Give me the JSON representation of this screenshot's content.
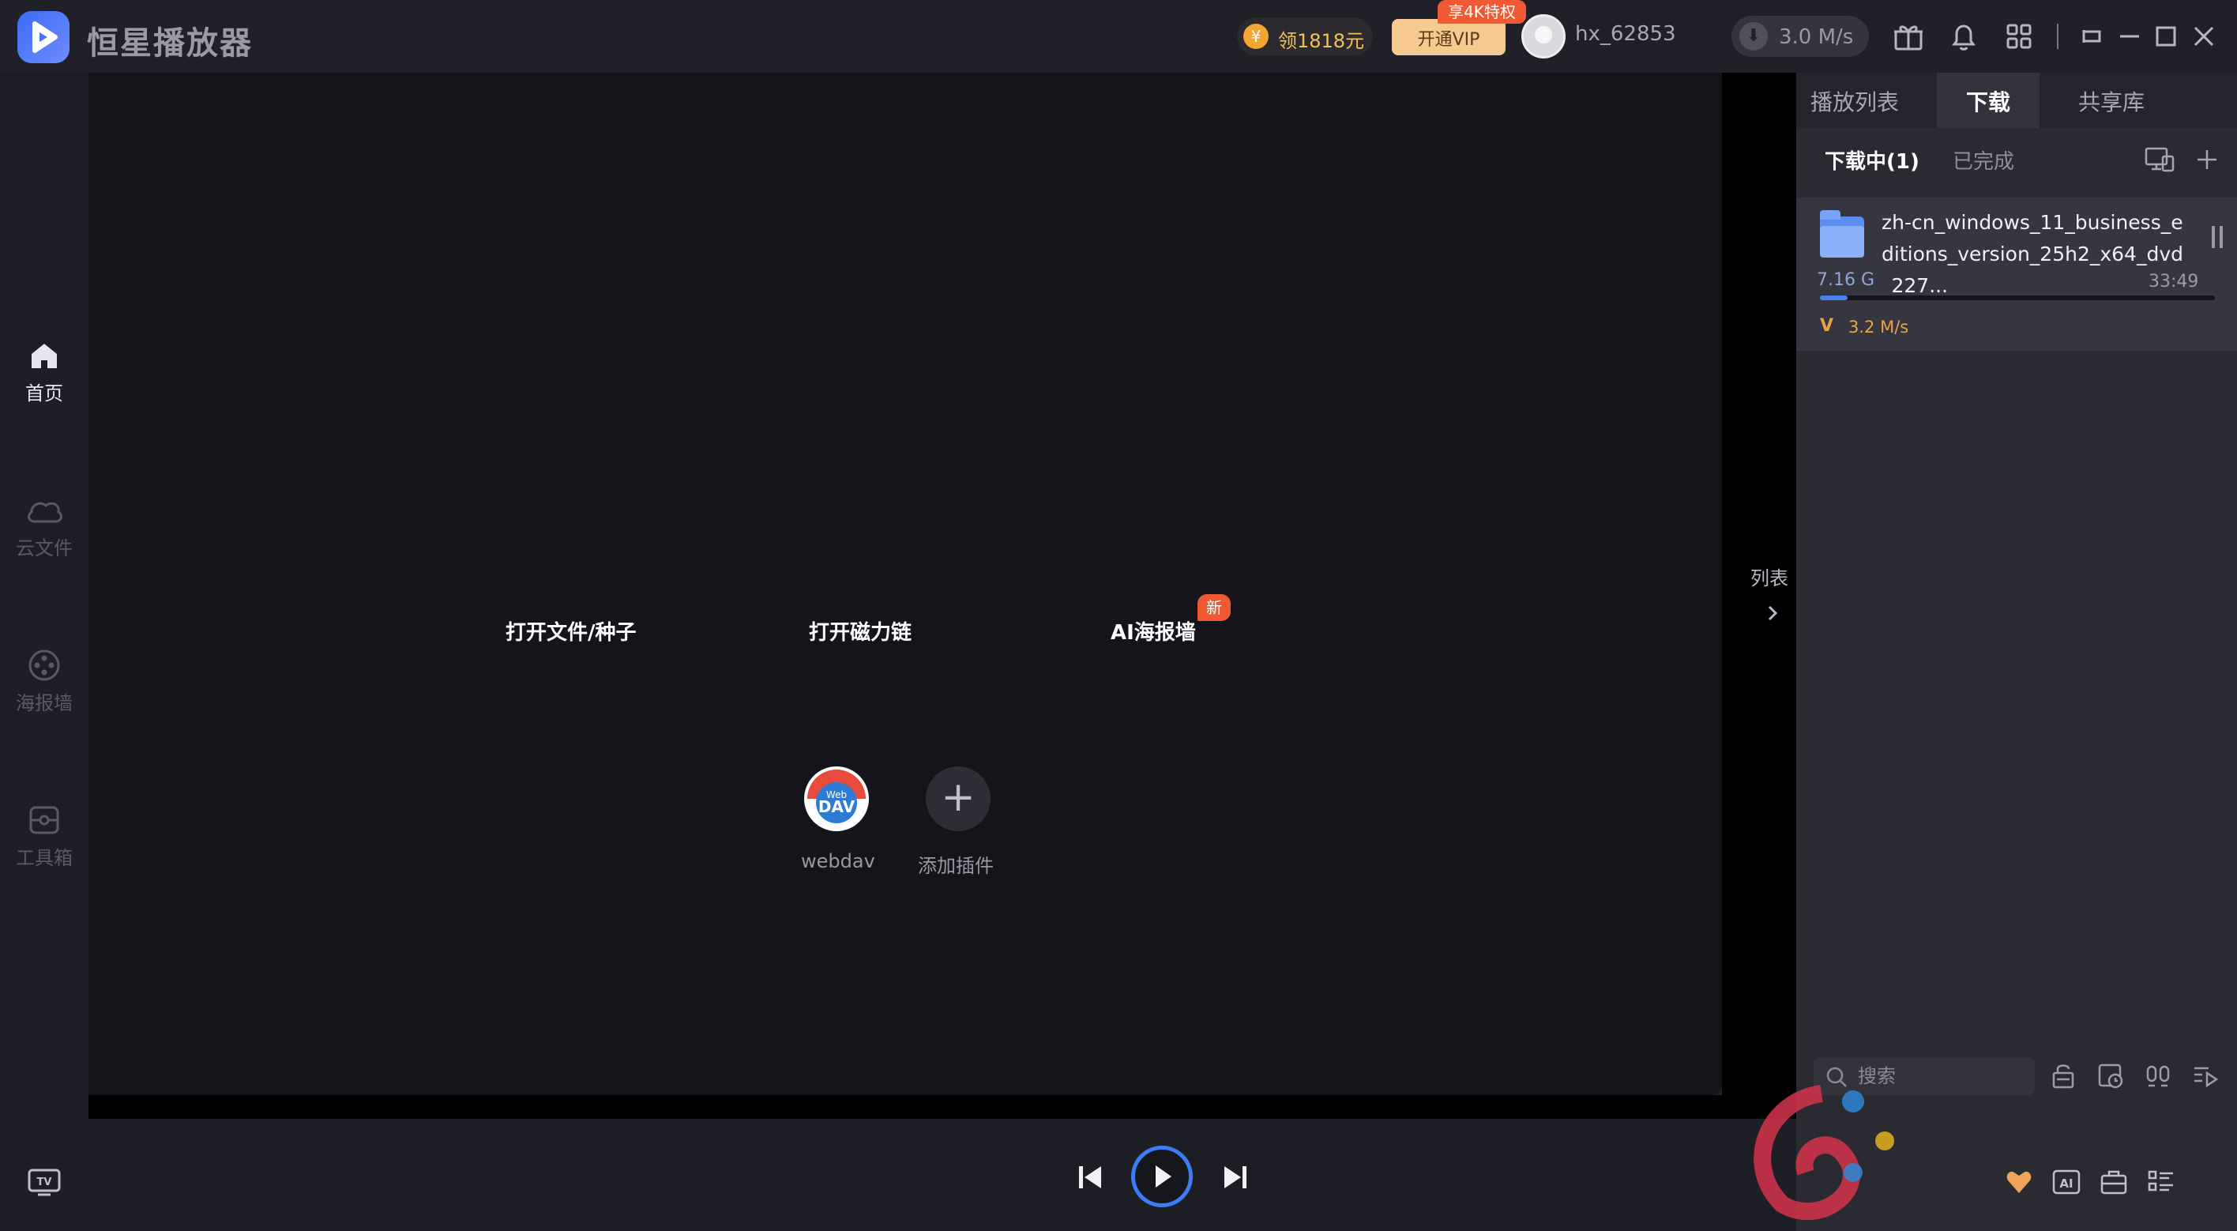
{
  "app": {
    "brand": "恒星播放器"
  },
  "titlebar": {
    "coin_offer": "领1818元",
    "vip_button": "开通VIP",
    "vip_badge": "享4K特权",
    "username": "hx_62853",
    "speed": "3.0 M/s"
  },
  "leftnav": {
    "items": [
      {
        "label": "首页",
        "icon": "home-icon",
        "active": true
      },
      {
        "label": "云文件",
        "icon": "cloud-icon",
        "active": false
      },
      {
        "label": "海报墙",
        "icon": "film-reel-icon",
        "active": false
      },
      {
        "label": "工具箱",
        "icon": "toolbox-icon",
        "active": false
      }
    ],
    "bottom_icon": "tv-icon"
  },
  "main": {
    "actions": [
      {
        "label": "打开文件/种子"
      },
      {
        "label": "打开磁力链"
      },
      {
        "label": "AI海报墙",
        "badge": "新"
      }
    ],
    "plugins": [
      {
        "label": "webdav",
        "icon_text": "DAV",
        "icon_small": "Web"
      },
      {
        "label": "添加插件",
        "icon": "plus-icon"
      }
    ],
    "side_list_label": "列表"
  },
  "rightpanel": {
    "tabs": [
      {
        "label": "播放列表",
        "active": false
      },
      {
        "label": "下载",
        "active": true
      },
      {
        "label": "共享库",
        "active": false
      }
    ],
    "subtabs": [
      {
        "label": "下载中(1)",
        "active": true
      },
      {
        "label": "已完成",
        "active": false
      }
    ],
    "download": {
      "filename": "zh-cn_windows_11_business_editions_version_25h2_x64_dvd_227...",
      "size": "7.16 G",
      "time_left": "33:49",
      "progress": 0.07,
      "speed": "3.2 M/s"
    },
    "search_placeholder": "搜索"
  },
  "colors": {
    "accent": "#3b7df6",
    "badge": "#ef5a35",
    "vip": "#f5c98f",
    "speed": "#e9a24a"
  }
}
